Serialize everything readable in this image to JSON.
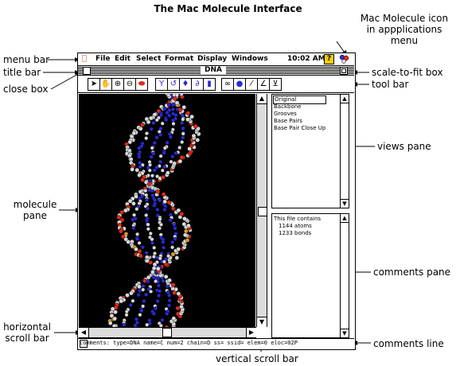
{
  "page_title": "The Mac Molecule Interface",
  "menubar": {
    "apple": "",
    "items": [
      "File",
      "Edit",
      "Select",
      "Format",
      "Display",
      "Windows"
    ],
    "clock": "10:02 AM",
    "help": "?"
  },
  "window": {
    "title": "DNA"
  },
  "views": {
    "items": [
      "Original",
      "Backbone",
      "Grooves",
      "Base Pairs",
      "Base Pair Close Up"
    ],
    "selected": "Original"
  },
  "comments": {
    "lines": [
      "This file contains",
      "1144 atoms",
      "1233 bonds"
    ]
  },
  "comments_line": "comments: type=DNA name=C num=2 chain=D ss=  ssid= elem=0 eloc=02P",
  "callouts": {
    "app_icon": "Mac Molecule icon\nin appplications menu",
    "menu_bar": "menu bar",
    "title_bar": "title bar",
    "close_box": "close box",
    "scale_to_fit": "scale-to-fit box",
    "tool_bar": "tool bar",
    "views_pane": "views pane",
    "molecule_pane": "molecule\npane",
    "comments_pane": "comments pane",
    "horizontal_scroll": "horizontal\nscroll bar",
    "comments_line": "comments line",
    "vertical_scroll": "vertical scroll bar"
  },
  "colors": {
    "atom_carbon": "#d8d8d8",
    "atom_oxygen": "#e02a1a",
    "atom_nitrogen": "#2a2ad8",
    "atom_phosphorus": "#e0a020",
    "pane_background": "#000000"
  }
}
